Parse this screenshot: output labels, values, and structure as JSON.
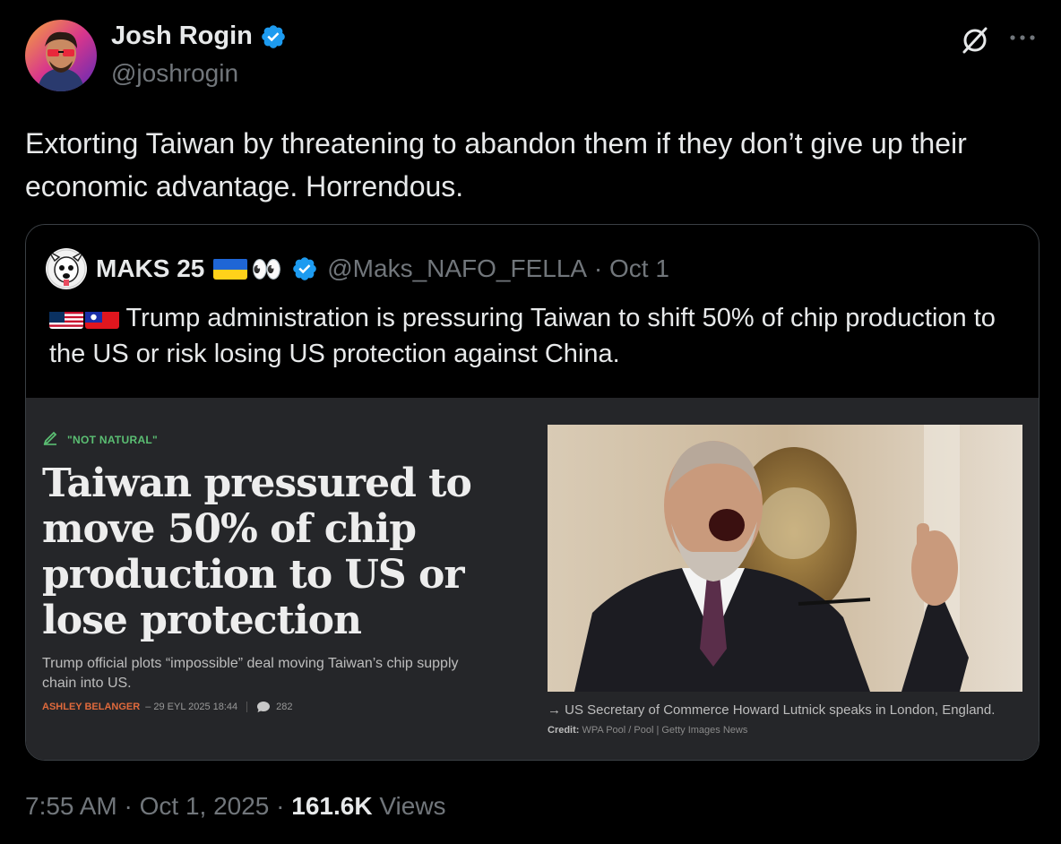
{
  "author": {
    "name": "Josh Rogin",
    "handle": "@joshrogin"
  },
  "tweet": {
    "text": "Extorting Taiwan by threatening to abandon them if they don’t give up their economic advantage. Horrendous."
  },
  "quote": {
    "name": "MAKS 25",
    "name_emoji": "👀",
    "handle": "@Maks_NAFO_FELLA",
    "date_sep": " · ",
    "date": "Oct 1",
    "text": "Trump administration is pressuring Taiwan to shift 50% of chip production to the US or risk losing US protection against China."
  },
  "article": {
    "kicker": "\"NOT NATURAL\"",
    "headline": "Taiwan pressured to move 50% of chip production to US or lose protection",
    "subhead": "Trump official plots “impossible” deal moving Taiwan’s chip supply chain into US.",
    "author": "ASHLEY BELANGER",
    "date": "– 29 EYL 2025 18:44",
    "comments": "282",
    "caption": "US Secretary of Commerce Howard Lutnick speaks in London, England.",
    "caption_arrow": "→",
    "credit_label": "Credit:",
    "credit": "WPA Pool / Pool | Getty Images News"
  },
  "footer": {
    "time": "7:55 AM",
    "sep1": " · ",
    "date": "Oct 1, 2025",
    "sep2": " · ",
    "views_count": "161.6K",
    "views_label": " Views"
  },
  "icons": {
    "verified": "verified-badge-icon",
    "grok": "grok-icon",
    "more": "more-options-icon",
    "comment": "comment-bubble-icon",
    "kicker": "kicker-pen-icon"
  },
  "colors": {
    "background": "#000000",
    "text_primary": "#e7e9ea",
    "text_secondary": "#71767b",
    "verified_blue": "#1d9bf0",
    "article_bg": "#252629",
    "kicker_green": "#5bbf73",
    "author_orange": "#e06a3c"
  }
}
